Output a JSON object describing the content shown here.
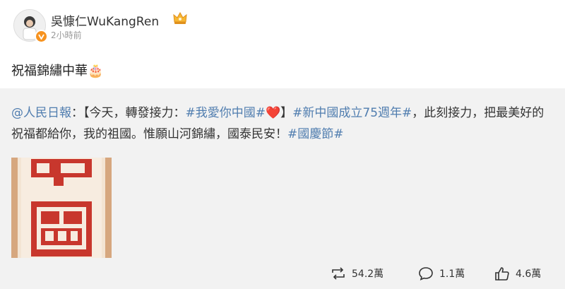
{
  "post": {
    "username": "吳慷仁WuKangRen",
    "timestamp": "2小時前",
    "text": "祝福錦繡中華",
    "text_emoji": "🎂"
  },
  "repost": {
    "author": "@人民日報",
    "author_sep": "：",
    "part1": "【今天，轉發接力：",
    "hashtag1": "#我愛你中國#",
    "heart": "❤️",
    "part2": "】",
    "hashtag2": "#新中國成立75週年#",
    "part3": "，此刻接力，把最美好的祝福都給你，我的祖國。惟願山河錦繡，國泰民安！",
    "hashtag3": "#國慶節#"
  },
  "actions": {
    "repost_count": "54.2萬",
    "comment_count": "1.1萬",
    "like_count": "4.6萬"
  },
  "colors": {
    "link": "#eb7350",
    "repost_bg": "#f2f2f2",
    "badge": "#f79320",
    "papercut_red": "#c8372d"
  },
  "icons": [
    "verified-badge-icon",
    "crown-badge-icon",
    "repost-icon",
    "comment-icon",
    "like-icon"
  ]
}
